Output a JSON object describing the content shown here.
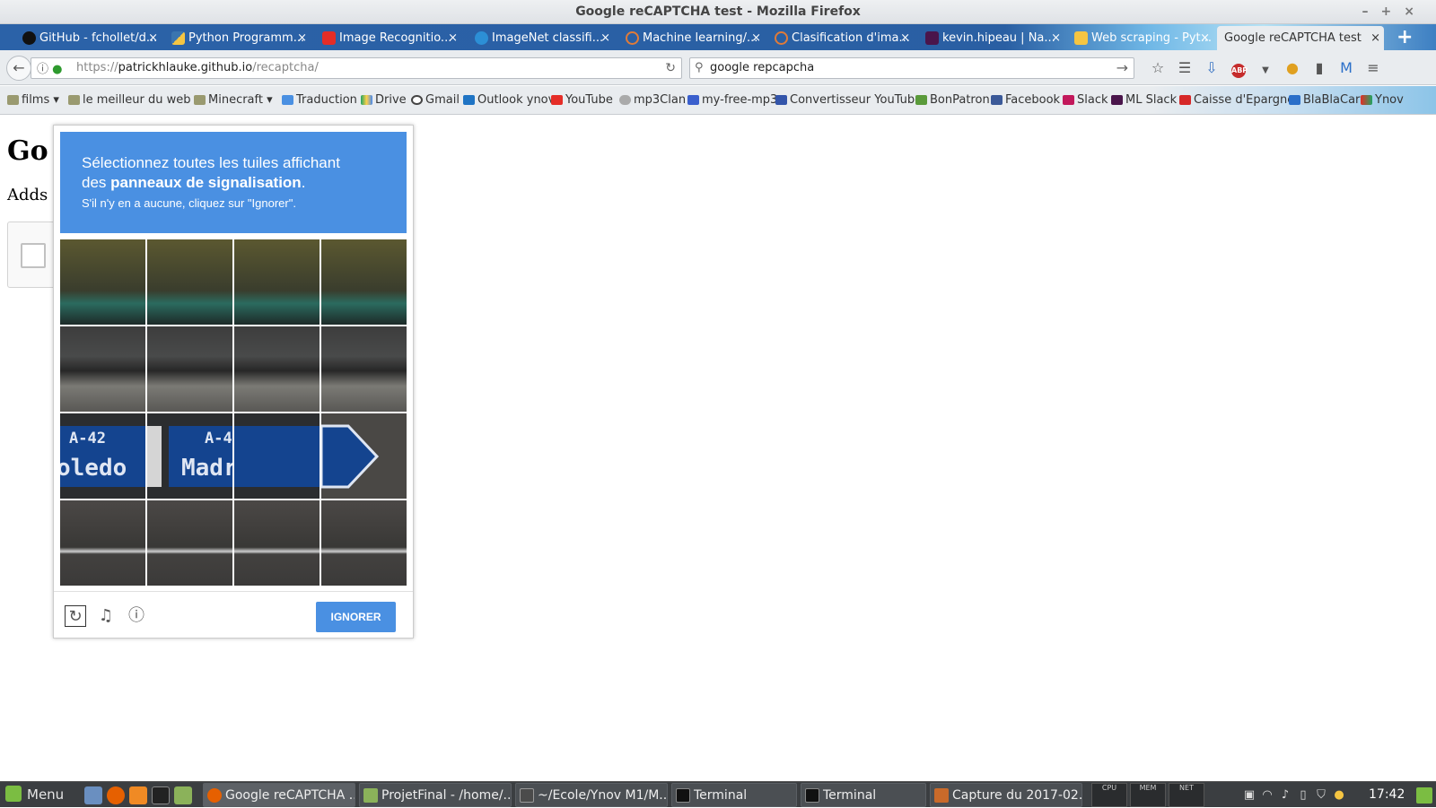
{
  "window": {
    "title": "Google reCAPTCHA test - Mozilla Firefox"
  },
  "tabs": [
    {
      "label": "GitHub - fchollet/d...",
      "color": "#111111"
    },
    {
      "label": "Python Programm...",
      "color": "#f5c542"
    },
    {
      "label": "Image Recognitio...",
      "color": "#e52d27"
    },
    {
      "label": "ImageNet classifi...",
      "color": "#2c8fd6"
    },
    {
      "label": "Machine learning/...",
      "color": "#e07b39"
    },
    {
      "label": "Clasification d'ima...",
      "color": "#e07b39"
    },
    {
      "label": "kevin.hipeau | Na...",
      "color": "#4a154b"
    },
    {
      "label": "Web scraping - Pyt...",
      "color": "#f5c542"
    },
    {
      "label": "Google reCAPTCHA test",
      "color": "#4a90e2"
    }
  ],
  "nav": {
    "url_prefix": "https://",
    "url_host": "patrickhlauke.github.io",
    "url_path": "/recaptcha/",
    "search_value": "google repcapcha"
  },
  "bookmarks": [
    "films",
    "le meilleur du web",
    "Minecraft",
    "Traduction",
    "Drive",
    "Gmail",
    "Outlook ynov",
    "YouTube",
    "mp3Clan",
    "my-free-mp3",
    "Convertisseur YouTube",
    "BonPatron",
    "Facebook",
    "Slack",
    "ML Slack",
    "Caisse d'Epargne",
    "BlaBlaCar",
    "Ynov"
  ],
  "page": {
    "title": "Go",
    "desc": "Adds t"
  },
  "captcha": {
    "instruction_line1": "Sélectionnez toutes les tuiles affichant",
    "instruction_prefix": "des ",
    "instruction_bold": "panneaux de signalisation",
    "instruction_suffix": ".",
    "sub": "S'il n'y en a aucune, cliquez sur \"Ignorer\".",
    "sign_code": "A-42",
    "sign_left_text": "oledo",
    "sign_right_text": "Madrid",
    "button_label": "IGNORER",
    "accent": "#4a90e2"
  },
  "taskbar": {
    "menu_label": "Menu",
    "tasks": [
      "Google reCAPTCHA ...",
      "ProjetFinal - /home/...",
      "~/Ecole/Ynov M1/M...",
      "Terminal",
      "Terminal",
      "Capture du 2017-02..."
    ],
    "monitors": [
      "CPU",
      "MEM",
      "NET"
    ],
    "clock": "17:42"
  }
}
